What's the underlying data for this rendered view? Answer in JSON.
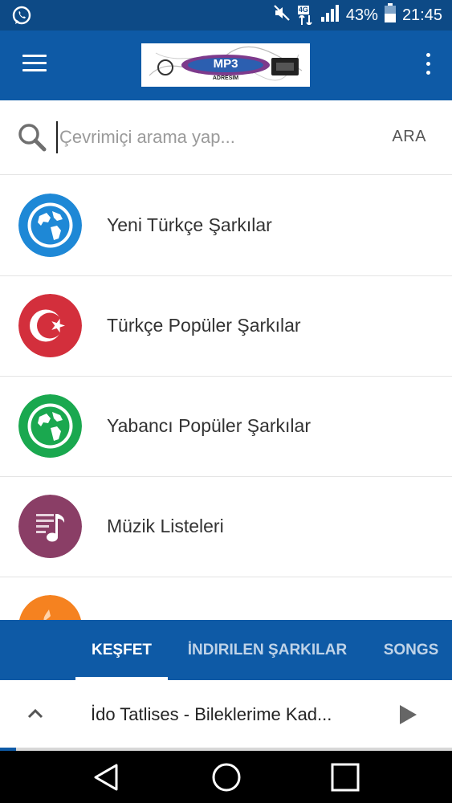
{
  "status_bar": {
    "battery": "43%",
    "time": "21:45",
    "network": "4G"
  },
  "app_bar": {
    "logo_text": "MP3",
    "logo_subtext": "ADRESIM"
  },
  "search": {
    "placeholder": "Çevrimiçi arama yap...",
    "value": "",
    "button_label": "ARA"
  },
  "categories": [
    {
      "label": "Yeni Türkçe Şarkılar",
      "icon": "globe-icon",
      "color": "#1e88d6"
    },
    {
      "label": "Türkçe Popüler Şarkılar",
      "icon": "turkish-flag-icon",
      "color": "#d32f3c"
    },
    {
      "label": "Yabancı Popüler Şarkılar",
      "icon": "globe-icon",
      "color": "#1aa84f"
    },
    {
      "label": "Müzik Listeleri",
      "icon": "music-playlist-icon",
      "color": "#8a3e66"
    },
    {
      "label": "",
      "icon": "flame-icon",
      "color": "#f58220"
    }
  ],
  "tabs": [
    {
      "label": "KEŞFET",
      "active": true
    },
    {
      "label": "İNDIRILEN ŞARKILAR",
      "active": false
    },
    {
      "label": "SONGS",
      "active": false
    }
  ],
  "player": {
    "title": "İdo Tatlises - Bileklerime Kad...",
    "progress": 0.035
  },
  "colors": {
    "primary": "#0e5aa6",
    "status_bar": "#0d4a86"
  }
}
